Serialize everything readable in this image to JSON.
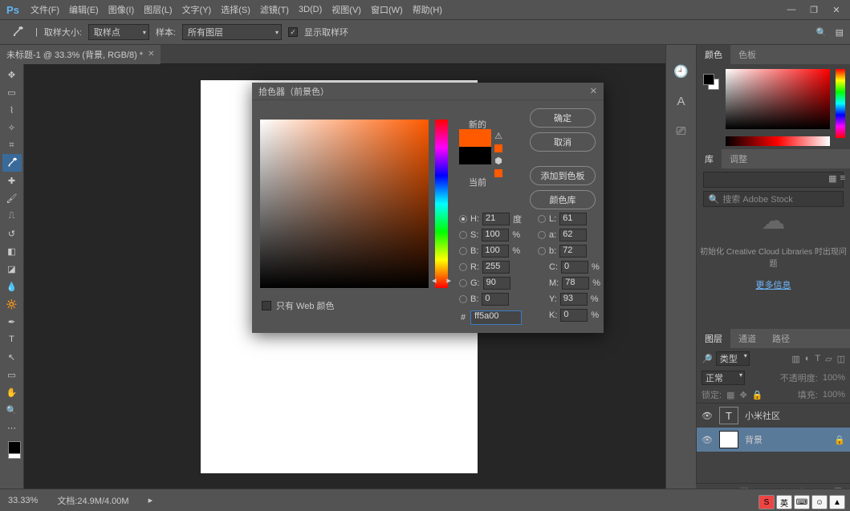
{
  "menubar": {
    "items": [
      "文件(F)",
      "编辑(E)",
      "图像(I)",
      "图层(L)",
      "文字(Y)",
      "选择(S)",
      "滤镜(T)",
      "3D(D)",
      "视图(V)",
      "窗口(W)",
      "帮助(H)"
    ]
  },
  "options": {
    "sample_size_label": "取样大小:",
    "sample_size_value": "取样点",
    "sample_label": "样本:",
    "sample_value": "所有图层",
    "show_ring": "显示取样环"
  },
  "doc_tab": "未标题-1 @ 33.3% (背景, RGB/8) *",
  "status": {
    "zoom": "33.33%",
    "docinfo": "文档:24.9M/4.00M"
  },
  "panels": {
    "color_tab": "颜色",
    "swatches_tab": "色板",
    "lib_tab": "库",
    "adjust_tab": "调整",
    "lib_search": "搜索 Adobe Stock",
    "lib_msg": "初始化 Creative Cloud Libraries 时出现问题",
    "lib_link": "更多信息",
    "layers_tab": "图层",
    "channels_tab": "通道",
    "paths_tab": "路径",
    "kind": "类型",
    "blend": "正常",
    "opacity_lbl": "不透明度:",
    "opacity": "100%",
    "lock_lbl": "锁定:",
    "fill_lbl": "填充:",
    "fill": "100%",
    "layer1": "小米社区",
    "layer2": "背景"
  },
  "picker": {
    "title": "拾色器（前景色）",
    "new": "新的",
    "current": "当前",
    "ok": "确定",
    "cancel": "取消",
    "add": "添加到色板",
    "libs": "颜色库",
    "webonly": "只有 Web 颜色",
    "H": {
      "label": "H:",
      "val": "21",
      "unit": "度"
    },
    "S": {
      "label": "S:",
      "val": "100",
      "unit": "%"
    },
    "B": {
      "label": "B:",
      "val": "100",
      "unit": "%"
    },
    "R": {
      "label": "R:",
      "val": "255"
    },
    "G": {
      "label": "G:",
      "val": "90"
    },
    "Bb": {
      "label": "B:",
      "val": "0"
    },
    "L": {
      "label": "L:",
      "val": "61"
    },
    "a": {
      "label": "a:",
      "val": "62"
    },
    "b": {
      "label": "b:",
      "val": "72"
    },
    "C": {
      "label": "C:",
      "val": "0",
      "unit": "%"
    },
    "M": {
      "label": "M:",
      "val": "78",
      "unit": "%"
    },
    "Y": {
      "label": "Y:",
      "val": "93",
      "unit": "%"
    },
    "K": {
      "label": "K:",
      "val": "0",
      "unit": "%"
    },
    "hex_label": "#",
    "hex": "ff5a00"
  },
  "tray": [
    "S",
    "英",
    "⌨",
    "☺",
    "▲"
  ]
}
